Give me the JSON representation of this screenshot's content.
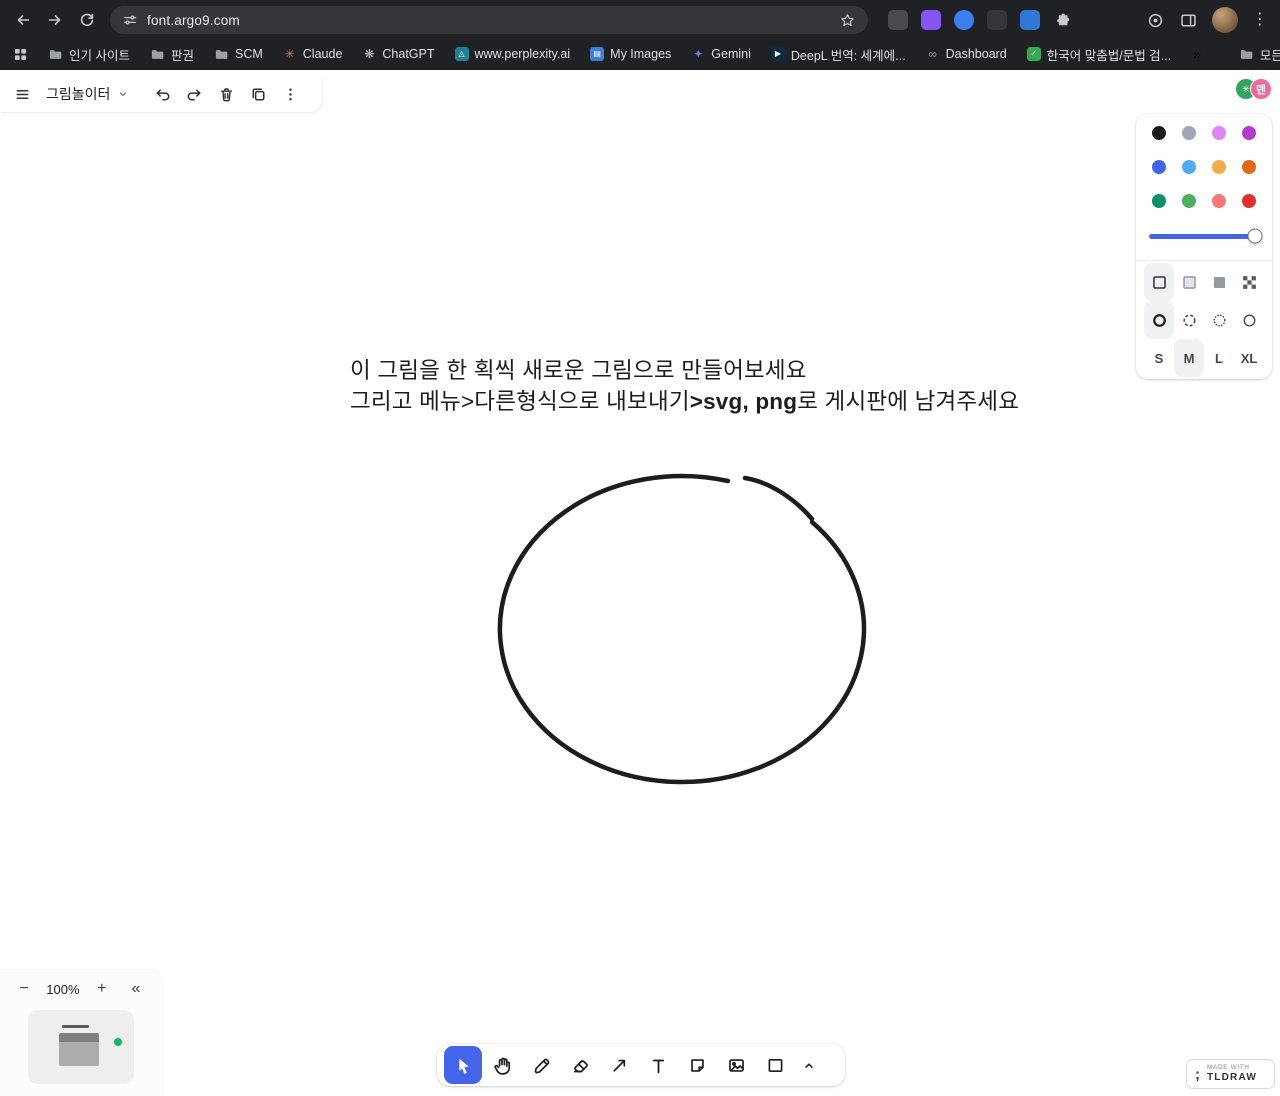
{
  "browser": {
    "url": "font.argo9.com",
    "icons": {
      "star": "☆",
      "kebab": "⋮",
      "overflow": "»",
      "collapse": "«",
      "minus": "−",
      "plus": "+"
    },
    "bookmarks": [
      {
        "label": "인기 사이트",
        "icon": "folder"
      },
      {
        "label": "판권",
        "icon": "folder"
      },
      {
        "label": "SCM",
        "icon": "folder"
      },
      {
        "label": "Claude",
        "icon": "glyph",
        "glyph": "✳",
        "color": "#d97757"
      },
      {
        "label": "ChatGPT",
        "icon": "glyph",
        "glyph": "❋",
        "color": "#c3c7cb"
      },
      {
        "label": "www.perplexity.ai",
        "icon": "tile",
        "glyph": "◬",
        "color": "#20808d"
      },
      {
        "label": "My Images",
        "icon": "tile",
        "glyph": "▤",
        "color": "#3f7fd6"
      },
      {
        "label": "Gemini",
        "icon": "glyph",
        "glyph": "✦",
        "color": "#5f7de9"
      },
      {
        "label": "DeepL 번역: 세계에...",
        "icon": "tile",
        "glyph": "▶",
        "color": "#0f2b46"
      },
      {
        "label": "Dashboard",
        "icon": "glyph",
        "glyph": "∞",
        "color": "#8f9aa6"
      },
      {
        "label": "한국어 맞춤법/문법 검...",
        "icon": "tile",
        "glyph": "✓",
        "color": "#34a853"
      }
    ],
    "all_bookmarks_label": "모든 북마크"
  },
  "app": {
    "title": "그림놀이터",
    "accent": "#4465e9",
    "presence": {
      "badge_text": "덴",
      "badge_color": "#f06a9e",
      "peer_color": "#35a45f",
      "peer_glyph": "✳"
    },
    "style_panel": {
      "colors": [
        "#1d1d1d",
        "#9fa8b2",
        "#e085f4",
        "#ae3ec9",
        "#4263eb",
        "#4dabf7",
        "#f1ac4b",
        "#e16919",
        "#099268",
        "#4cb05e",
        "#f87777",
        "#e03131"
      ],
      "sizes": [
        "S",
        "M",
        "L",
        "XL"
      ],
      "selected_size": "M"
    },
    "canvas_text": {
      "line1": "이 그림을 한 획씩 새로운 그림으로 만들어보세요",
      "line2_normal1": "그리고 메뉴>다른형식으로 내보내기",
      "line2_bold": ">svg, png",
      "line2_normal2": "로 게시판에 남겨주세요"
    },
    "zoom_label": "100%",
    "watermark": {
      "line1": "MADE WITH",
      "line2": "TLDRAW"
    }
  }
}
